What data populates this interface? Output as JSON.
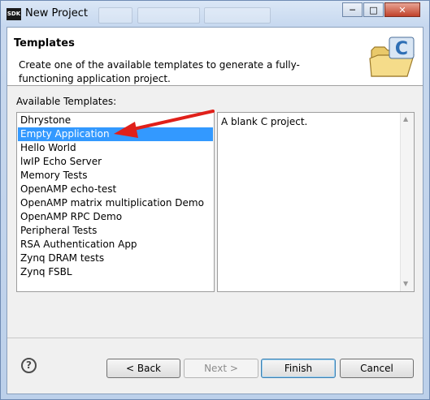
{
  "window": {
    "app_icon_text": "SDK",
    "title": "New Project",
    "minimize_glyph": "─",
    "maximize_glyph": "□",
    "close_glyph": "✕"
  },
  "banner": {
    "title": "Templates",
    "description": "Create one of the available templates to generate a fully-functioning application project.",
    "icon": "folder-c-icon"
  },
  "templates": {
    "label": "Available Templates:",
    "selected_index": 1,
    "items": [
      "Dhrystone",
      "Empty Application",
      "Hello World",
      "lwIP Echo Server",
      "Memory Tests",
      "OpenAMP echo-test",
      "OpenAMP matrix multiplication Demo",
      "OpenAMP RPC Demo",
      "Peripheral Tests",
      "RSA Authentication App",
      "Zynq DRAM tests",
      "Zynq FSBL"
    ],
    "description": "A blank C project."
  },
  "buttons": {
    "help": "?",
    "back": "< Back",
    "next": "Next >",
    "finish": "Finish",
    "cancel": "Cancel"
  },
  "colors": {
    "selection": "#3399ff",
    "annotation_arrow": "#e0201a"
  }
}
